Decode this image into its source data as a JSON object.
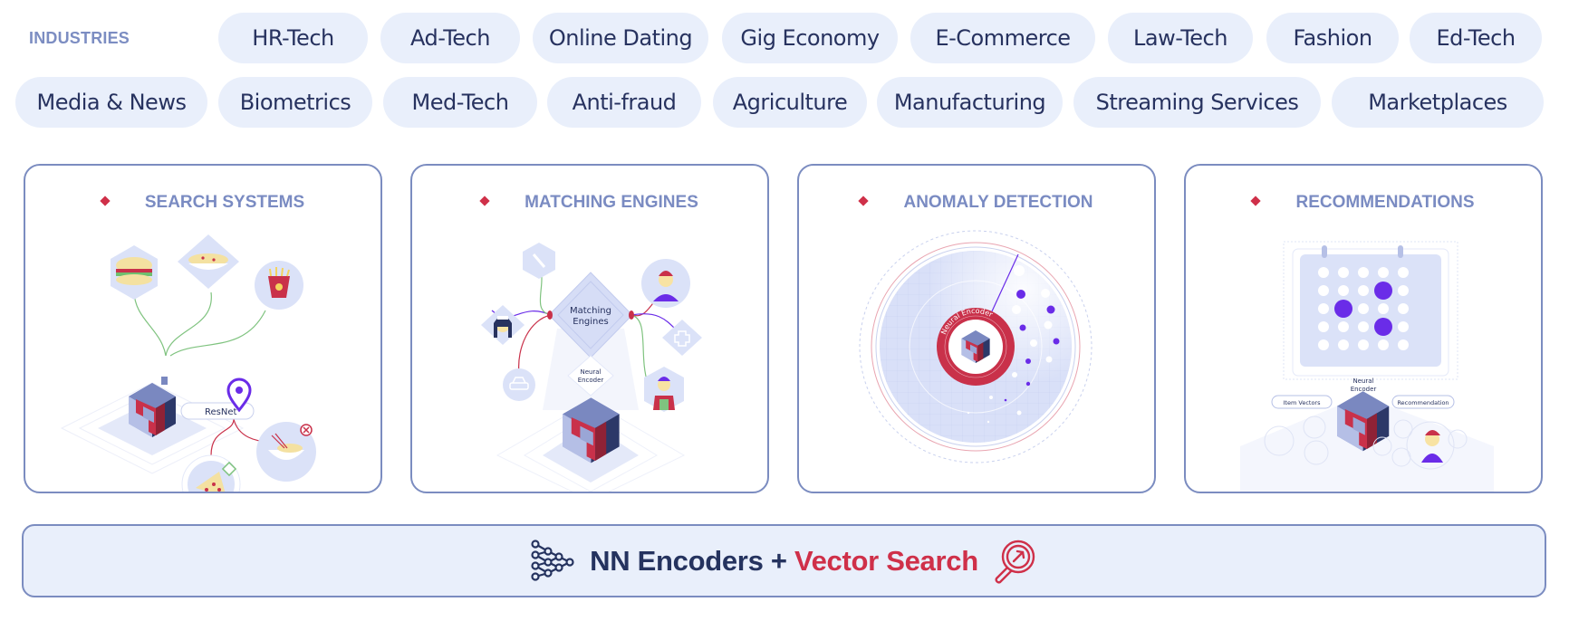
{
  "industries": {
    "label": "INDUSTRIES",
    "row1": [
      "HR-Tech",
      "Ad-Tech",
      "Online Dating",
      "Gig Economy",
      "E-Commerce",
      "Law-Tech",
      "Fashion",
      "Ed-Tech"
    ],
    "row2": [
      "Media & News",
      "Biometrics",
      "Med-Tech",
      "Anti-fraud",
      "Agriculture",
      "Manufacturing",
      "Streaming Services",
      "Marketplaces"
    ]
  },
  "cards": [
    {
      "title": "SEARCH SYSTEMS",
      "labels": {
        "model": "ResNet"
      },
      "icons": [
        "burger-icon",
        "pasta-icon",
        "fries-icon",
        "pizza-icon",
        "noodles-icon",
        "location-pin-icon",
        "check-icon",
        "cross-icon",
        "encoder-cube-icon"
      ]
    },
    {
      "title": "MATCHING ENGINES",
      "labels": {
        "center_line1": "Matching",
        "center_line2": "Engines",
        "encoder_line1": "Neural",
        "encoder_line2": "Encoder"
      },
      "icons": [
        "wrench-icon",
        "nurse-icon",
        "car-icon",
        "driver-icon",
        "medical-cross-icon",
        "farmer-icon",
        "encoder-cube-icon"
      ]
    },
    {
      "title": "ANOMALY DETECTION",
      "labels": {
        "ring": "Neural Encoder"
      },
      "icons": [
        "radar-icon",
        "encoder-cube-icon"
      ]
    },
    {
      "title": "RECOMMENDATIONS",
      "labels": {
        "encoder_line1": "Neural",
        "encoder_line2": "Encoder",
        "left_tag": "Item Vectors",
        "right_tag": "Recommendation"
      },
      "icons": [
        "calendar-grid-icon",
        "car-icon",
        "cup-icon",
        "shirt-icon",
        "percent-icon",
        "dollar-icon",
        "list-icon",
        "star-icon",
        "user-icon",
        "encoder-cube-icon"
      ]
    }
  ],
  "banner": {
    "part1": "NN Encoders + ",
    "part2": "Vector Search",
    "left_icon": "neural-network-icon",
    "right_icon": "magnifier-icon"
  },
  "colors": {
    "accent": "#cf3049",
    "navy": "#25335f",
    "border": "#7b8cc0",
    "pill_bg": "#e9effb",
    "purple": "#6a2ce8"
  }
}
